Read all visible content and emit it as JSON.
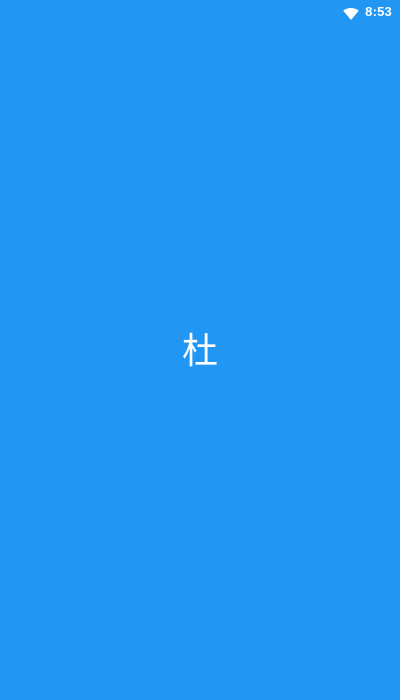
{
  "status_bar": {
    "time": "8:53",
    "wifi_icon": "wifi-icon"
  },
  "splash": {
    "character": "杜"
  },
  "colors": {
    "background": "#2196F3",
    "foreground": "#FFFFFF"
  }
}
